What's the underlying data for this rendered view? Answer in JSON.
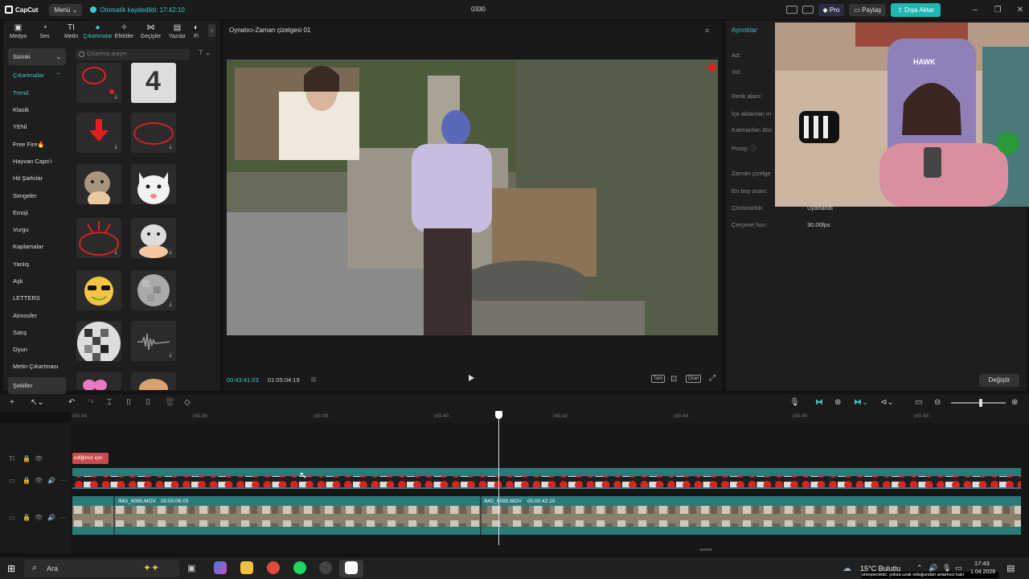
{
  "titlebar": {
    "app_name": "CapCut",
    "menu_label": "Menü",
    "saved_status": "Otomatik kaydedildi: 17:42:10",
    "project_name": "0330",
    "pro_label": "Pro",
    "share_label": "Paylaş",
    "export_label": "Dışa Aktar"
  },
  "media_tabs": [
    {
      "label": "Medya",
      "icon": "media-icon"
    },
    {
      "label": "Ses",
      "icon": "audio-icon"
    },
    {
      "label": "Metin",
      "icon": "text-icon"
    },
    {
      "label": "Çıkartmalar",
      "icon": "sticker-icon"
    },
    {
      "label": "Efektler",
      "icon": "effects-icon"
    },
    {
      "label": "Geçişler",
      "icon": "transitions-icon"
    },
    {
      "label": "Yazılar",
      "icon": "captions-icon"
    },
    {
      "label": "Fi",
      "icon": "filters-icon"
    }
  ],
  "categories": {
    "dropdown": "Sizinki",
    "section": "Çıkartmalar",
    "items": [
      "Trend",
      "Klasik",
      "YENİ",
      "Free Fire🔥",
      "Hayvan Caps'i",
      "Hit Şarkılar",
      "Simgeler",
      "Emoji",
      "Vurgu",
      "Kaplamalar",
      "Yanlış",
      "Aşk",
      "LETTERS",
      "Atmosfer",
      "Satış",
      "Oyun",
      "Metin Çıkartması"
    ],
    "bottom": "Şekiller"
  },
  "search": {
    "placeholder": "Çıkartma arayın"
  },
  "sticker_four": "4",
  "player": {
    "title": "Oynatıcı-Zaman çizelgesi 01",
    "current_time": "00:43:41:03",
    "total_time": "01:05:04:19",
    "full_label": "Tam",
    "ratio_label": "Oran"
  },
  "details": {
    "title": "Ayrıntılar",
    "rows": [
      {
        "label": "Ad:",
        "value": ""
      },
      {
        "label": "Yol:",
        "value": ""
      },
      {
        "label": "Renk alanı:",
        "value": ""
      },
      {
        "label": "İçe aktarılan m",
        "value": ""
      },
      {
        "label": "Katmanları düz",
        "value": ""
      },
      {
        "label": "Proxy:",
        "value": ""
      },
      {
        "label": "Zaman çizelge",
        "value": ""
      },
      {
        "label": "En boy oranı:",
        "value": ""
      },
      {
        "label": "Çözünürlük:",
        "value": "Uyarlandı"
      },
      {
        "label": "Çerçeve hızı:",
        "value": "30.00fps"
      }
    ],
    "change_label": "Değiştir"
  },
  "webcam_logo": "HAWK",
  "timeline": {
    "ruler_labels": [
      "|43:34",
      "|43:36",
      "|43:38",
      "|43:40",
      "|43:42",
      "|43:44",
      "|43:46",
      "|43:48"
    ],
    "text_clip": "ediğimiz için",
    "clip1_name": "IMG_6085.MOV",
    "clip1_dur": "00:00:06:03",
    "clip2_name": "IMG_6085.MOV",
    "clip2_dur": "00:00:42:10"
  },
  "taskbar": {
    "search": "Ara",
    "weather_temp": "15°C",
    "weather_desc": "Bulutlu",
    "ticker": "unexpectedc: yoksa uzak olduğundan anlamsız kalır",
    "time": "17:43",
    "date": "1.04.2026"
  }
}
